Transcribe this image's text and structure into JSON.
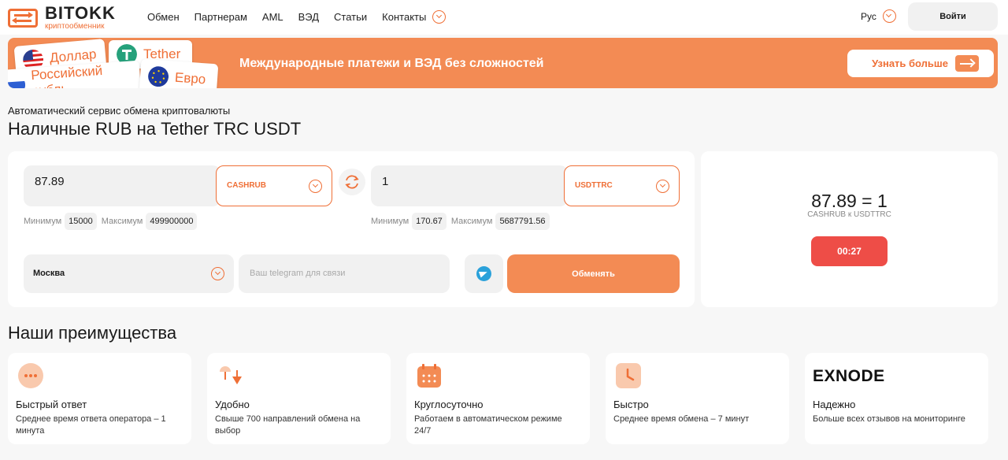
{
  "header": {
    "logo_name": "BITOKK",
    "logo_sub": "криптообменник",
    "nav": [
      "Обмен",
      "Партнерам",
      "AML",
      "ВЭД",
      "Статьи",
      "Контакты"
    ],
    "lang": "Рус",
    "login": "Войти"
  },
  "banner": {
    "cards": [
      "Доллар",
      "Tether",
      "Российский рубль",
      "Евро"
    ],
    "text": "Международные платежи и ВЭД без сложностей",
    "button": "Узнать больше"
  },
  "hero": {
    "subtitle": "Автоматический сервис обмена криптовалюты",
    "title": "Наличные RUB на Tether TRC USDT"
  },
  "exchange": {
    "give_amount": "87.89",
    "give_currency": "CASHRUB",
    "get_amount": "1",
    "get_currency": "USDTTRC",
    "min_label": "Минимум",
    "max_label": "Максимум",
    "give_min": "15000",
    "give_max": "499900000",
    "get_min": "170.67",
    "get_max": "5687791.56",
    "city": "Москва",
    "telegram_placeholder": "Ваш telegram для связи",
    "submit": "Обменять"
  },
  "rate": {
    "value": "87.89 = 1",
    "pair": "CASHRUB к USDTTRC",
    "timer": "00:27"
  },
  "advantages": {
    "title": "Наши преимущества",
    "items": [
      {
        "name": "Быстрый ответ",
        "desc": "Среднее время ответа оператора – 1 минута",
        "icon": "chat-icon"
      },
      {
        "name": "Удобно",
        "desc": "Свыше 700 направлений обмена на выбор",
        "icon": "directions-icon"
      },
      {
        "name": "Круглосуточно",
        "desc": "Работаем в автоматическом режиме 24/7",
        "icon": "calendar-icon"
      },
      {
        "name": "Быстро",
        "desc": "Среднее время обмена – 7 минут",
        "icon": "clock-icon"
      },
      {
        "name": "Надежно",
        "desc": "Больше всех отзывов на мониторинге",
        "icon": "exnode-logo",
        "logo_text": "EXNODE"
      }
    ]
  },
  "colors": {
    "accent": "#ef6f36",
    "banner": "#f38b54",
    "timer": "#ee4d47",
    "telegram": "#2aa1da"
  }
}
